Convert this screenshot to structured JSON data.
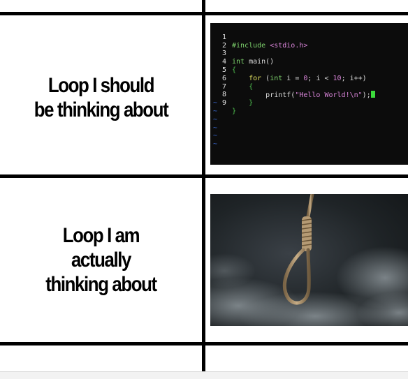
{
  "panels": [
    {
      "caption": "Loop I should\nbe thinking about"
    },
    {
      "caption": "Loop I am\nactually\nthinking about"
    }
  ],
  "code": {
    "line_numbers": [
      "1",
      "2",
      "3",
      "4",
      "5",
      "6",
      "7",
      "8",
      "9"
    ],
    "include_directive": "#include",
    "include_header": "<stdio.h>",
    "main_type": "int",
    "main_sig": " main()",
    "brace_open": "{",
    "brace_close": "}",
    "for_kw": "for",
    "for_open": " (",
    "for_int": "int",
    "for_init": " i = ",
    "zero": "0",
    "for_cond": "; i < ",
    "ten": "10",
    "for_end": "; i++)",
    "printf_fn": "printf(",
    "printf_arg": "\"Hello World!\\n\"",
    "printf_end": ");",
    "tilde": "~"
  },
  "colors": {
    "background": "#ffffff",
    "grid": "#000000",
    "terminal_bg": "#0c0c0c",
    "cursor": "#3cdc3c"
  }
}
